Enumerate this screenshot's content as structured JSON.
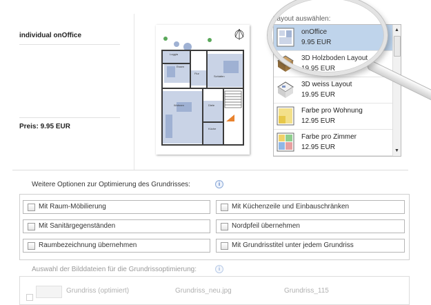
{
  "product": {
    "name": "individual onOffice",
    "price": "Preis: 9.95 EUR"
  },
  "layout_picker": {
    "heading": "Layout auswählen:",
    "items": [
      {
        "name": "onOffice",
        "price": "9.95 EUR",
        "selected": true
      },
      {
        "name": "3D Holzboden Layout",
        "price": "19.95 EUR",
        "selected": false
      },
      {
        "name": "3D weiss Layout",
        "price": "19.95 EUR",
        "selected": false
      },
      {
        "name": "Farbe pro Wohnung",
        "price": "12.95 EUR",
        "selected": false
      },
      {
        "name": "Farbe pro Zimmer",
        "price": "12.95 EUR",
        "selected": false
      }
    ]
  },
  "options": {
    "title": "Weitere Optionen zur Optimierung des Grundrisses:",
    "items": [
      {
        "label": "Mit Raum-Möbilierung",
        "checked": false
      },
      {
        "label": "Mit Küchenzeile und Einbauschränken",
        "checked": false
      },
      {
        "label": "Mit Sanitärgegenständen",
        "checked": false
      },
      {
        "label": "Nordpfeil übernehmen",
        "checked": false
      },
      {
        "label": "Raumbezeichnung übernehmen",
        "checked": false
      },
      {
        "label": "Mit Grundrisstitel unter jedem Grundriss",
        "checked": false
      }
    ]
  },
  "images": {
    "title": "Auswahl der Bilddateien für die Grundrissoptimierung:",
    "files": [
      {
        "name": "Grundriss (optimiert)",
        "file": "Grundriss_neu.jpg",
        "id": "Grundriss_115"
      }
    ]
  },
  "plan_labels": {
    "loggia": "Loggia",
    "essen": "Essen",
    "flur": "Flur",
    "schlafen": "Schlafen",
    "wohnen": "Wohnen",
    "diele": "Diele",
    "kueche": "Küche"
  },
  "colors": {
    "selected_row": "#bcd2ea",
    "plan_floor": "#c9d3e6",
    "plan_furniture": "#9fb1d3",
    "info_icon": "#5b82c7"
  }
}
